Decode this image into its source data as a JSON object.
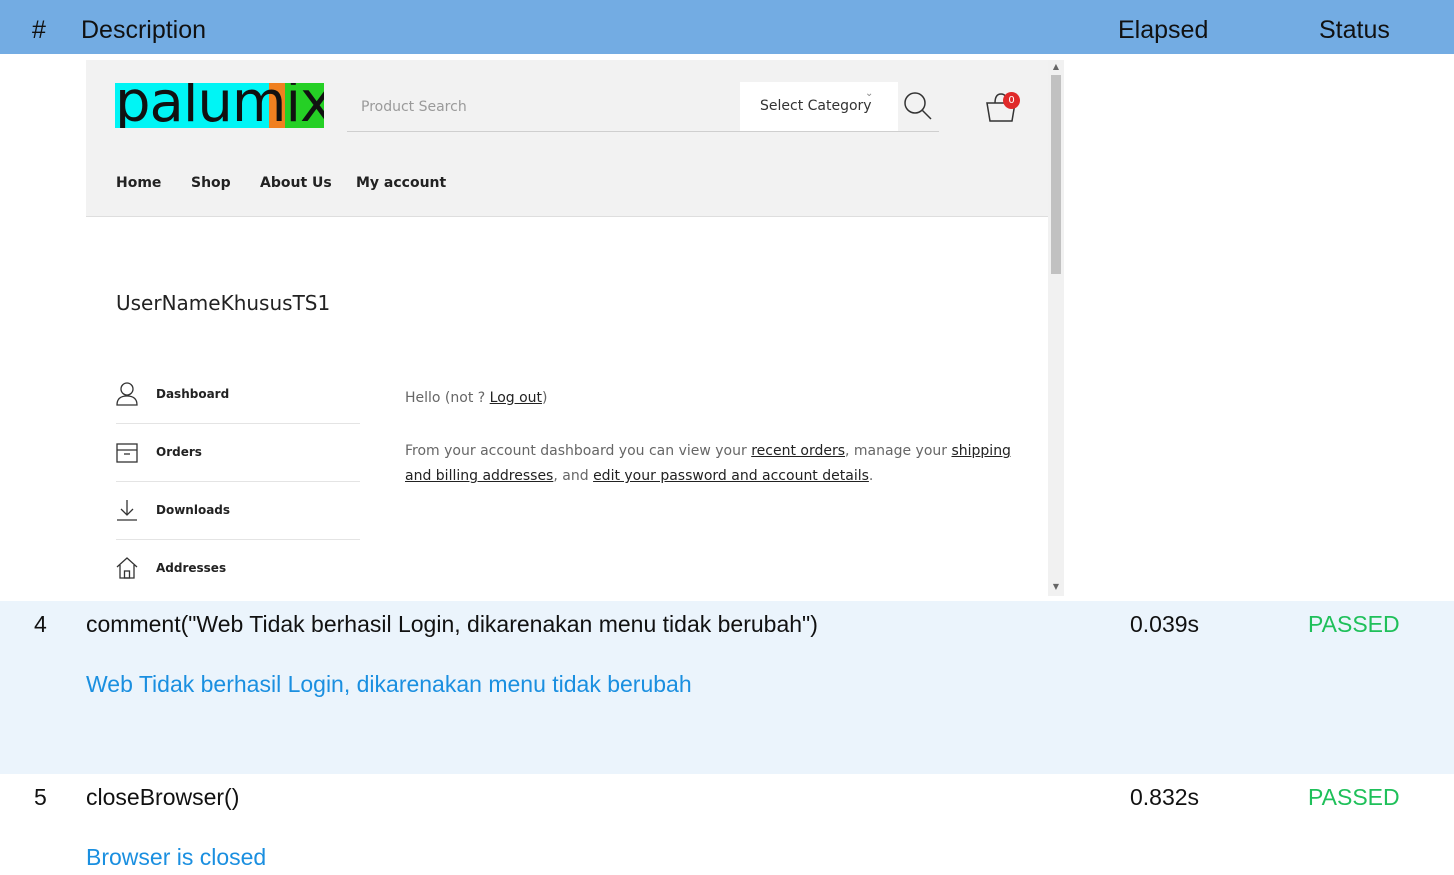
{
  "report": {
    "header": {
      "num": "#",
      "description": "Description",
      "elapsed": "Elapsed",
      "status": "Status"
    },
    "rows": [
      {
        "num": "4",
        "description": "comment(\"Web Tidak berhasil Login, dikarenakan menu tidak berubah\")",
        "elapsed": "0.039s",
        "status": "PASSED",
        "message": "Web Tidak berhasil Login, dikarenakan menu tidak berubah"
      },
      {
        "num": "5",
        "description": "closeBrowser()",
        "elapsed": "0.832s",
        "status": "PASSED",
        "message": "Browser is closed"
      }
    ],
    "colors": {
      "header_bg": "#73ace3",
      "passed": "#1fc05a",
      "message": "#1a8fe0",
      "row_alt": "#ebf4fc"
    }
  },
  "site": {
    "logo": "palumix",
    "search_placeholder": "Product Search",
    "category": "Select Category",
    "cart_count": "0",
    "nav": [
      "Home",
      "Shop",
      "About Us",
      "My account"
    ],
    "username": "UserNameKhususTS1",
    "account_menu": [
      {
        "label": "Dashboard",
        "icon": "user-icon"
      },
      {
        "label": "Orders",
        "icon": "box-icon"
      },
      {
        "label": "Downloads",
        "icon": "download-icon"
      },
      {
        "label": "Addresses",
        "icon": "home-icon"
      }
    ],
    "hello": {
      "prefix": "Hello (not ? ",
      "logout": "Log out",
      "suffix": ")"
    },
    "dash": {
      "t1": "From your account dashboard you can view your ",
      "l1": "recent orders",
      "t2": ", manage your ",
      "l2": "shipping and billing addresses",
      "t3": ", and ",
      "l3": "edit your password and account details",
      "t4": "."
    }
  }
}
